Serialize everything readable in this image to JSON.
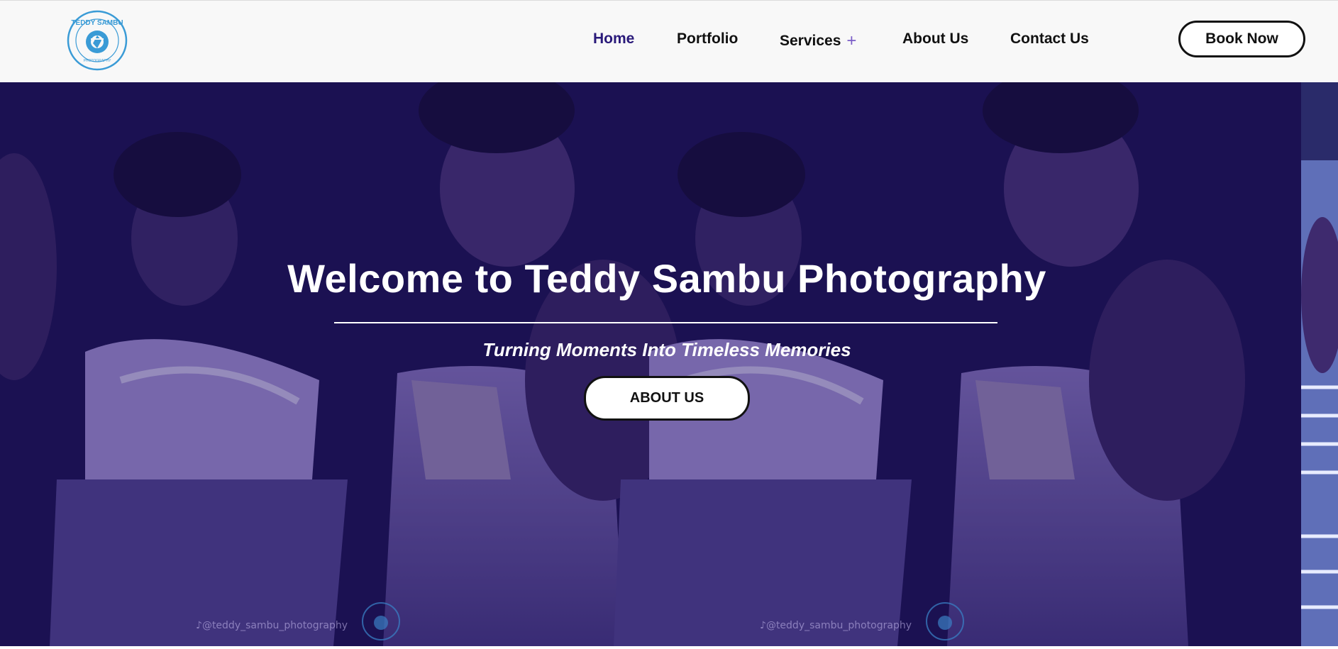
{
  "header": {
    "logo_text": "TEDDY SAMBU",
    "logo_subtext": "PHOTOGRAPHY",
    "nav": [
      {
        "label": "Home",
        "active": true
      },
      {
        "label": "Portfolio",
        "active": false
      },
      {
        "label": "Services",
        "active": false,
        "expand_symbol": "+"
      },
      {
        "label": "About Us",
        "active": false
      },
      {
        "label": "Contact Us",
        "active": false
      }
    ],
    "book_label": "Book Now"
  },
  "hero": {
    "title": "Welcome to Teddy Sambu Photography",
    "subtitle": "Turning Moments Into Timeless Memories",
    "button_label": "ABOUT US",
    "watermark_text": "@teddy_sambu_photography"
  },
  "colors": {
    "active_nav": "#2a1a7a",
    "hero_overlay": "#1b1150",
    "logo_blue": "#3a9bd6"
  }
}
